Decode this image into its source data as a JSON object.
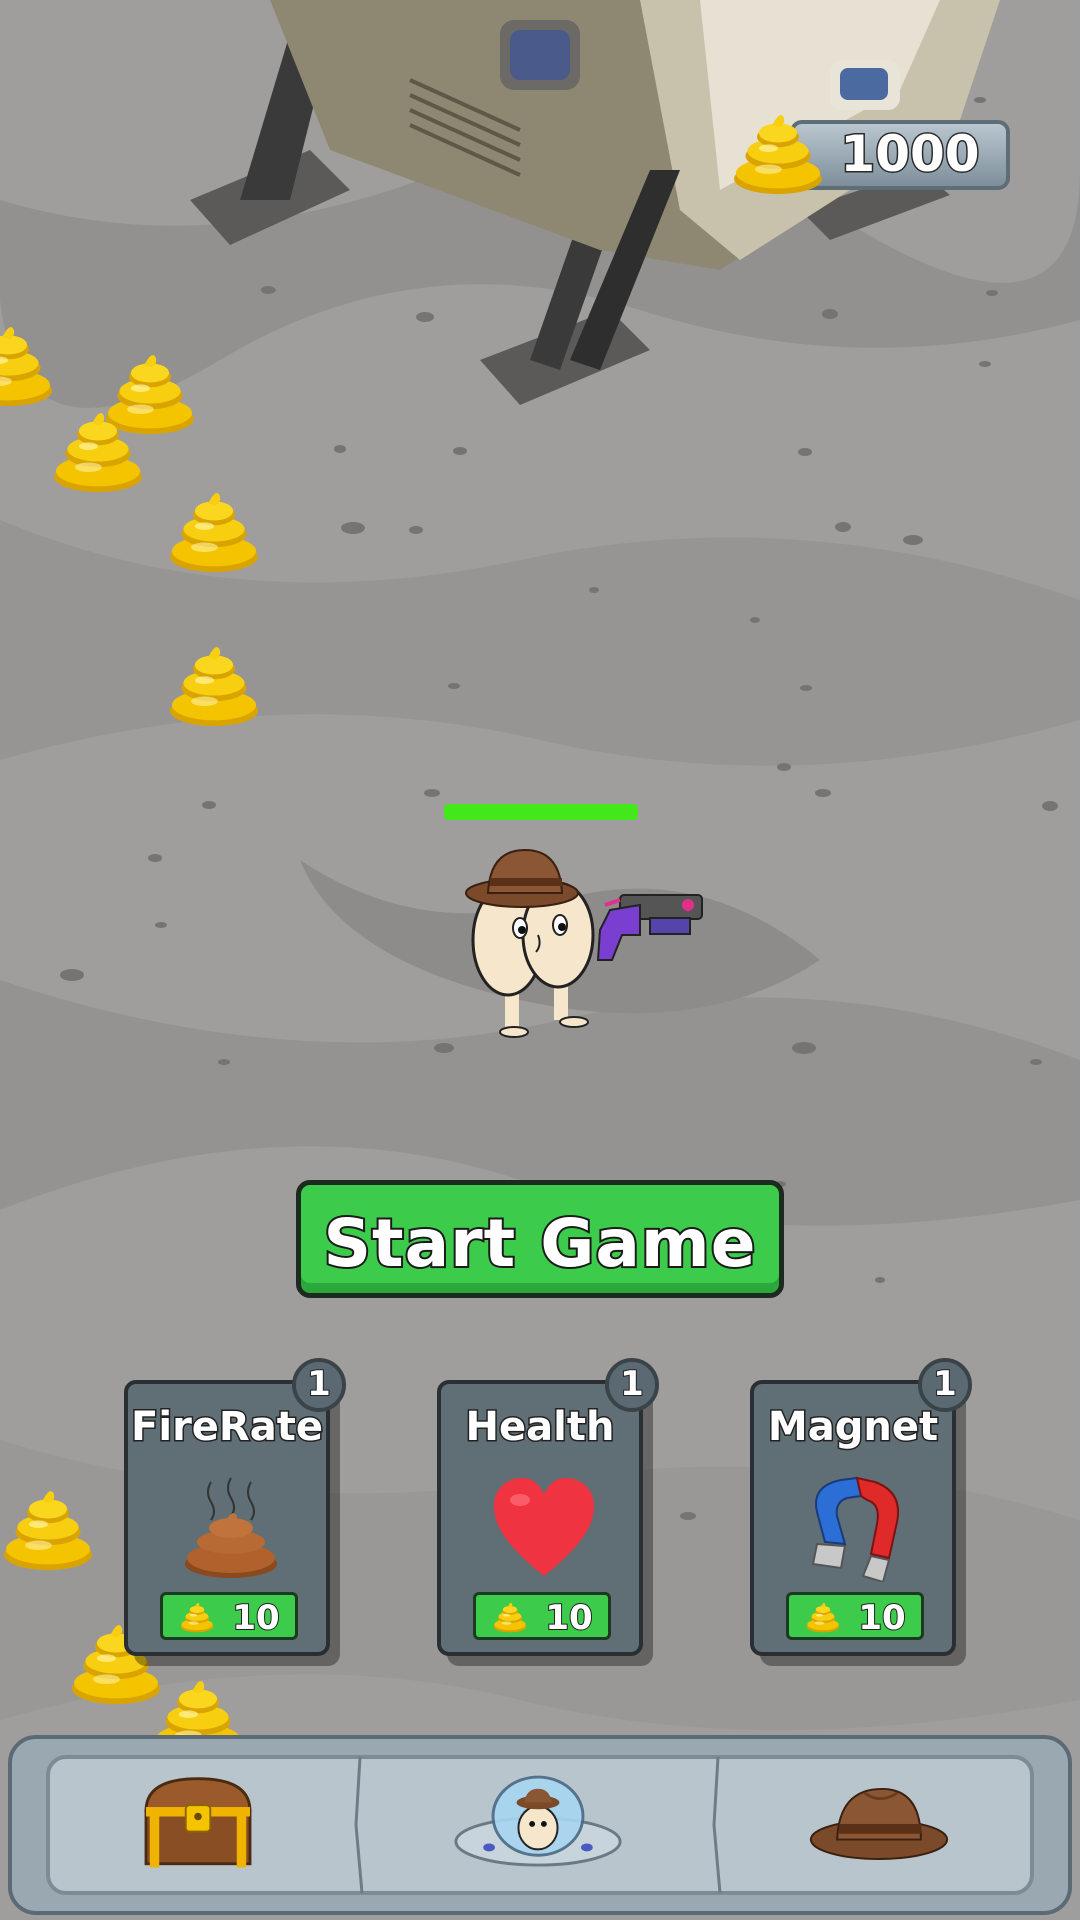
{
  "hud": {
    "currency_icon": "poop-coin-icon",
    "coins": "1000"
  },
  "player": {
    "character": "butt-character-with-hat",
    "weapon": "blaster-gun",
    "health_fraction": 1.0,
    "health_color": "#43e81b"
  },
  "start_button": {
    "label": "Start Game",
    "color": "#3ccb4b"
  },
  "upgrades": [
    {
      "title": "FireRate",
      "level": "1",
      "icon": "poop-icon",
      "price": "10"
    },
    {
      "title": "Health",
      "level": "1",
      "icon": "heart-icon",
      "price": "10"
    },
    {
      "title": "Magnet",
      "level": "1",
      "icon": "magnet-icon",
      "price": "10"
    }
  ],
  "bottom_nav": [
    {
      "name": "chest",
      "icon": "treasure-chest-icon"
    },
    {
      "name": "ship",
      "icon": "ufo-icon"
    },
    {
      "name": "hat",
      "icon": "hat-icon"
    }
  ]
}
